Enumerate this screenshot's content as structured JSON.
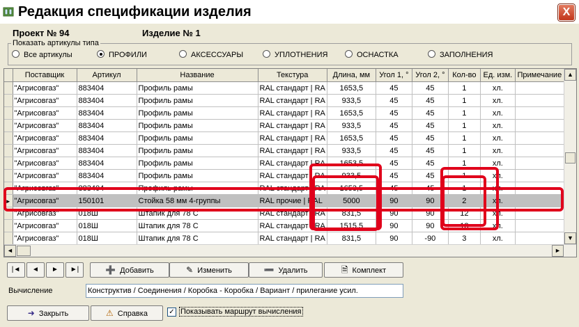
{
  "window": {
    "title": "Редакция спецификации изделия",
    "close_label": "X"
  },
  "header": {
    "project": "Проект № 94",
    "item": "Изделие № 1"
  },
  "filter": {
    "legend": "Показать артикулы типа",
    "options": [
      {
        "label": "Все артикулы",
        "selected": false
      },
      {
        "label": "ПРОФИЛИ",
        "selected": true
      },
      {
        "label": "АКСЕССУАРЫ",
        "selected": false
      },
      {
        "label": "УПЛОТНЕНИЯ",
        "selected": false
      },
      {
        "label": "ОСНАСТКА",
        "selected": false
      },
      {
        "label": "ЗАПОЛНЕНИЯ",
        "selected": false
      }
    ]
  },
  "grid": {
    "columns": [
      "Поставщик",
      "Артикул",
      "Название",
      "Текстура",
      "Длина, мм",
      "Угол 1, °",
      "Угол 2, °",
      "Кол-во",
      "Ед. изм.",
      "Примечание"
    ],
    "rows": [
      [
        "\"Агрисовгаз\"",
        "883404",
        "Профиль рамы",
        "RAL стандарт | RA",
        "1653,5",
        "45",
        "45",
        "1",
        "хл.",
        ""
      ],
      [
        "\"Агрисовгаз\"",
        "883404",
        "Профиль рамы",
        "RAL стандарт | RA",
        "933,5",
        "45",
        "45",
        "1",
        "хл.",
        ""
      ],
      [
        "\"Агрисовгаз\"",
        "883404",
        "Профиль рамы",
        "RAL стандарт | RA",
        "1653,5",
        "45",
        "45",
        "1",
        "хл.",
        ""
      ],
      [
        "\"Агрисовгаз\"",
        "883404",
        "Профиль рамы",
        "RAL стандарт | RA",
        "933,5",
        "45",
        "45",
        "1",
        "хл.",
        ""
      ],
      [
        "\"Агрисовгаз\"",
        "883404",
        "Профиль рамы",
        "RAL стандарт | RA",
        "1653,5",
        "45",
        "45",
        "1",
        "хл.",
        ""
      ],
      [
        "\"Агрисовгаз\"",
        "883404",
        "Профиль рамы",
        "RAL стандарт | RA",
        "933,5",
        "45",
        "45",
        "1",
        "хл.",
        ""
      ],
      [
        "\"Агрисовгаз\"",
        "883404",
        "Профиль рамы",
        "RAL стандарт | RA",
        "1653,5",
        "45",
        "45",
        "1",
        "хл.",
        ""
      ],
      [
        "\"Агрисовгаз\"",
        "883404",
        "Профиль рамы",
        "RAL стандарт | RA",
        "933,5",
        "45",
        "45",
        "1",
        "хл.",
        ""
      ],
      [
        "\"Агрисовгаз\"",
        "883404",
        "Профиль рамы",
        "RAL стандарт | RA",
        "1653,5",
        "45",
        "45",
        "1",
        "хл.",
        ""
      ],
      [
        "\"Агрисовгаз\"",
        "150101",
        "Стойка 58 мм 4-группы",
        "RAL прочие | RAL",
        "5000",
        "90",
        "90",
        "2",
        "хл.",
        ""
      ],
      [
        "\"Агрисовгаз\"",
        "018Ш",
        "Штапик для 78 С",
        "RAL стандарт | RA",
        "831,5",
        "90",
        "90",
        "12",
        "хл.",
        ""
      ],
      [
        "\"Агрисовгаз\"",
        "018Ш",
        "Штапик для 78 С",
        "RAL стандарт | RA",
        "1515,5",
        "90",
        "90",
        "18",
        "хл.",
        ""
      ],
      [
        "\"Агрисовгаз\"",
        "018Ш",
        "Штапик для 78 С",
        "RAL стандарт | RA",
        "831,5",
        "90",
        "-90",
        "3",
        "хл.",
        ""
      ]
    ],
    "selected_row": 9
  },
  "toolbar": {
    "first": "|◄",
    "prev": "◄",
    "next": "►",
    "last": "►|",
    "add": "Добавить",
    "edit": "Изменить",
    "delete": "Удалить",
    "kit": "Комплект"
  },
  "calc": {
    "label": "Вычисление",
    "value": "Конструктив / Соединения / Коробка - Коробка / Вариант / прилегание усил."
  },
  "bottom": {
    "close": "Закрыть",
    "help": "Справка",
    "show_route": "Показывать маршрут вычисления",
    "show_route_checked": true
  },
  "annotation_color": "#e0001b"
}
